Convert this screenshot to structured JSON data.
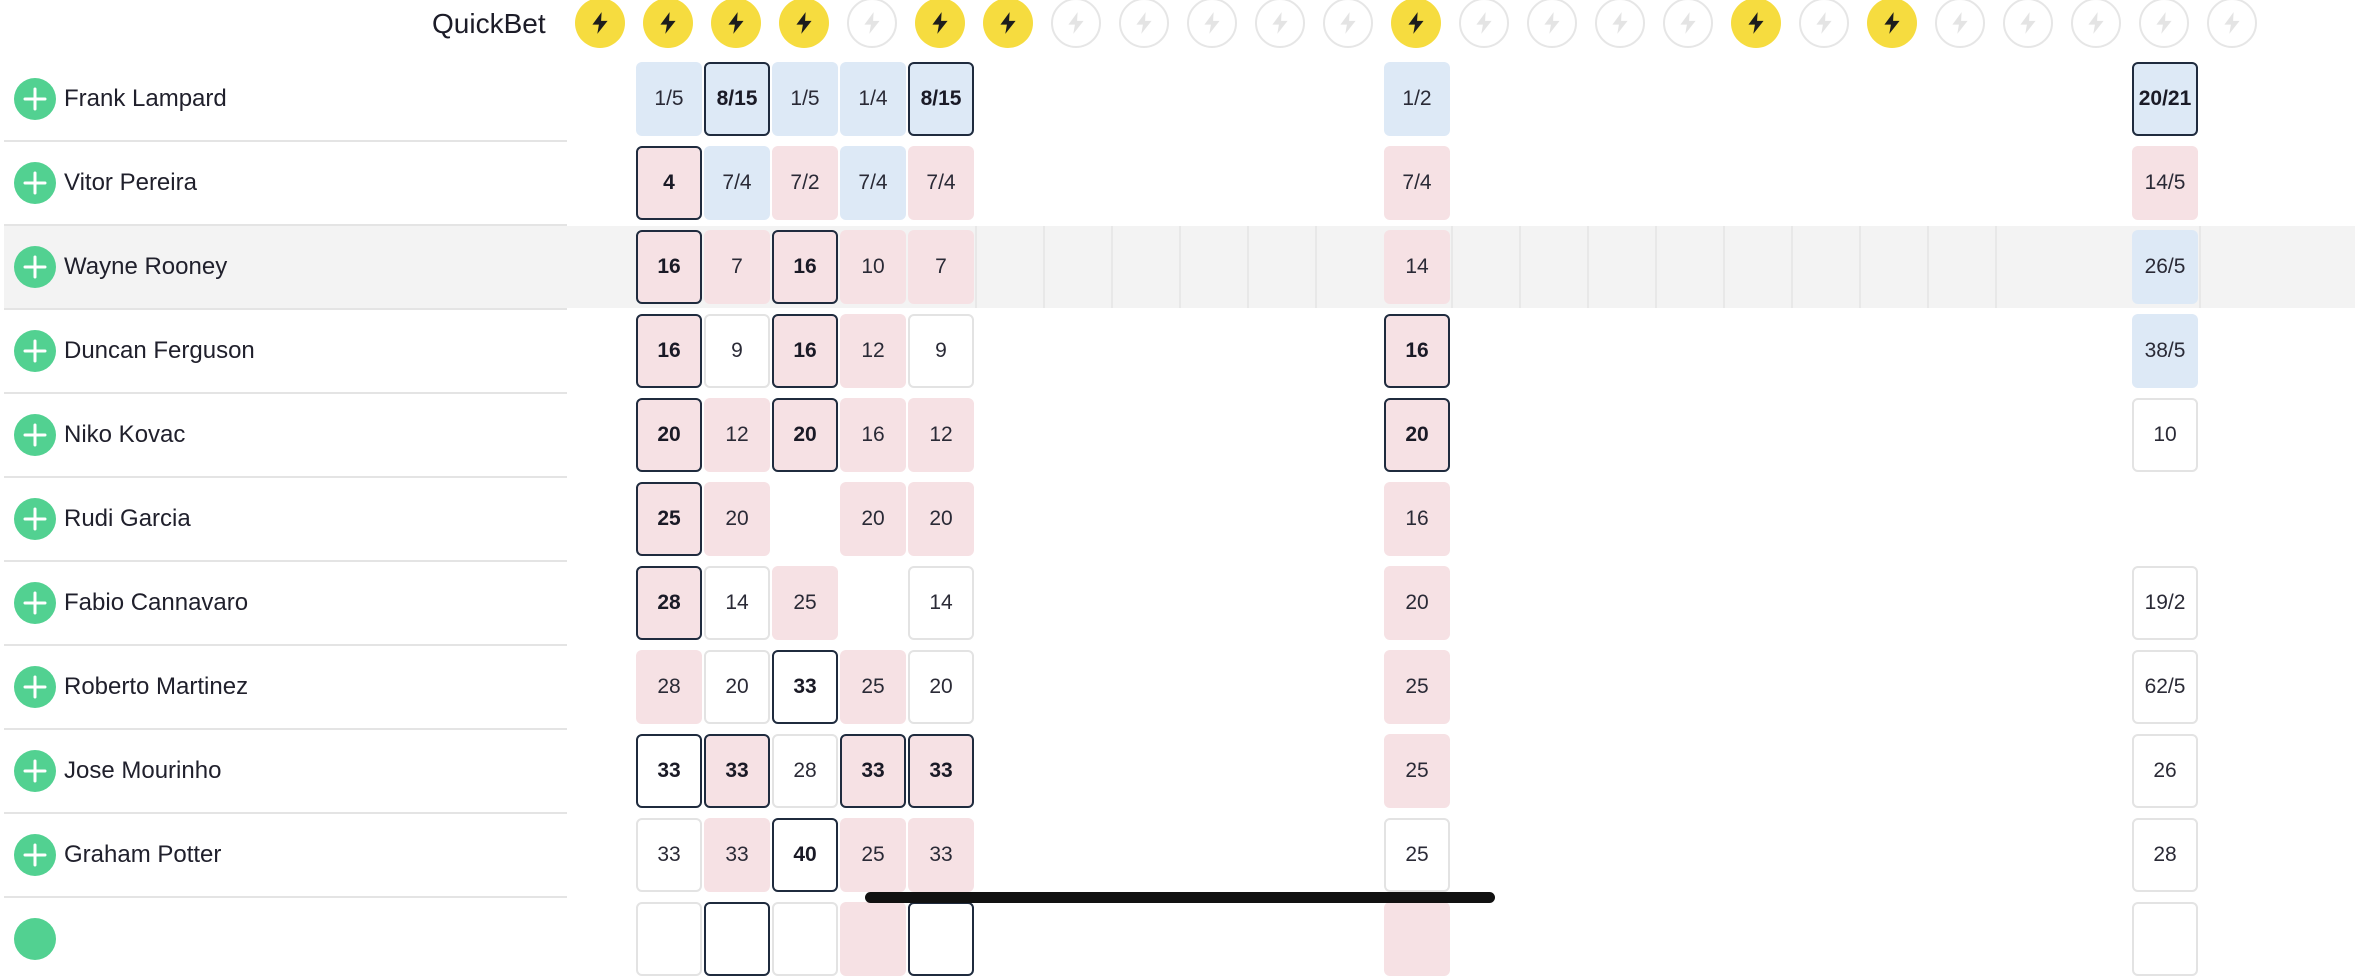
{
  "quickbet": {
    "label": "QuickBet",
    "states": [
      true,
      true,
      true,
      true,
      false,
      true,
      true,
      false,
      false,
      false,
      false,
      false,
      true,
      false,
      false,
      false,
      false,
      true,
      false,
      true,
      false,
      false,
      false,
      false,
      false
    ]
  },
  "icons": {
    "quickbet": "lightning-bolt-icon",
    "add": "plus-icon"
  },
  "colors": {
    "quickbet_on": "#f6dc3f",
    "add_button": "#52d191",
    "odds_shortening": "#dde9f6",
    "odds_drifting": "#f6e1e4",
    "best_price_border": "#1f2b3e"
  },
  "rows": [
    {
      "name": "Frank Lampard",
      "odds": [
        {
          "c": 1,
          "v": "1/5",
          "t": "b"
        },
        {
          "c": 2,
          "v": "8/15",
          "t": "b",
          "best": true
        },
        {
          "c": 3,
          "v": "1/5",
          "t": "b"
        },
        {
          "c": 4,
          "v": "1/4",
          "t": "b"
        },
        {
          "c": 5,
          "v": "8/15",
          "t": "b",
          "best": true
        },
        {
          "c": 12,
          "v": "1/2",
          "t": "b"
        },
        {
          "c": 23,
          "v": "20/21",
          "t": "b",
          "best": true
        }
      ]
    },
    {
      "name": "Vitor Pereira",
      "odds": [
        {
          "c": 1,
          "v": "4",
          "t": "p",
          "best": true
        },
        {
          "c": 2,
          "v": "7/4",
          "t": "b"
        },
        {
          "c": 3,
          "v": "7/2",
          "t": "p"
        },
        {
          "c": 4,
          "v": "7/4",
          "t": "b"
        },
        {
          "c": 5,
          "v": "7/4",
          "t": "p"
        },
        {
          "c": 12,
          "v": "7/4",
          "t": "p"
        },
        {
          "c": 23,
          "v": "14/5",
          "t": "p"
        }
      ]
    },
    {
      "name": "Wayne Rooney",
      "odds": [
        {
          "c": 1,
          "v": "16",
          "t": "p",
          "best": true
        },
        {
          "c": 2,
          "v": "7",
          "t": "p"
        },
        {
          "c": 3,
          "v": "16",
          "t": "p",
          "best": true
        },
        {
          "c": 4,
          "v": "10",
          "t": "p"
        },
        {
          "c": 5,
          "v": "7",
          "t": "p"
        },
        {
          "c": 12,
          "v": "14",
          "t": "p"
        },
        {
          "c": 23,
          "v": "26/5",
          "t": "b"
        }
      ]
    },
    {
      "name": "Duncan Ferguson",
      "odds": [
        {
          "c": 1,
          "v": "16",
          "t": "p",
          "best": true
        },
        {
          "c": 2,
          "v": "9",
          "t": "w"
        },
        {
          "c": 3,
          "v": "16",
          "t": "p",
          "best": true
        },
        {
          "c": 4,
          "v": "12",
          "t": "p"
        },
        {
          "c": 5,
          "v": "9",
          "t": "w"
        },
        {
          "c": 12,
          "v": "16",
          "t": "p",
          "best": true
        },
        {
          "c": 23,
          "v": "38/5",
          "t": "b"
        }
      ]
    },
    {
      "name": "Niko Kovac",
      "odds": [
        {
          "c": 1,
          "v": "20",
          "t": "p",
          "best": true
        },
        {
          "c": 2,
          "v": "12",
          "t": "p"
        },
        {
          "c": 3,
          "v": "20",
          "t": "p",
          "best": true
        },
        {
          "c": 4,
          "v": "16",
          "t": "p"
        },
        {
          "c": 5,
          "v": "12",
          "t": "p"
        },
        {
          "c": 12,
          "v": "20",
          "t": "p",
          "best": true
        },
        {
          "c": 23,
          "v": "10",
          "t": "w"
        }
      ]
    },
    {
      "name": "Rudi Garcia",
      "odds": [
        {
          "c": 1,
          "v": "25",
          "t": "p",
          "best": true
        },
        {
          "c": 2,
          "v": "20",
          "t": "p"
        },
        {
          "c": 4,
          "v": "20",
          "t": "p"
        },
        {
          "c": 5,
          "v": "20",
          "t": "p"
        },
        {
          "c": 12,
          "v": "16",
          "t": "p"
        }
      ]
    },
    {
      "name": "Fabio Cannavaro",
      "odds": [
        {
          "c": 1,
          "v": "28",
          "t": "p",
          "best": true
        },
        {
          "c": 2,
          "v": "14",
          "t": "w"
        },
        {
          "c": 3,
          "v": "25",
          "t": "p"
        },
        {
          "c": 5,
          "v": "14",
          "t": "w"
        },
        {
          "c": 12,
          "v": "20",
          "t": "p"
        },
        {
          "c": 23,
          "v": "19/2",
          "t": "w"
        }
      ]
    },
    {
      "name": "Roberto Martinez",
      "odds": [
        {
          "c": 1,
          "v": "28",
          "t": "p"
        },
        {
          "c": 2,
          "v": "20",
          "t": "w"
        },
        {
          "c": 3,
          "v": "33",
          "t": "w",
          "best": true
        },
        {
          "c": 4,
          "v": "25",
          "t": "p"
        },
        {
          "c": 5,
          "v": "20",
          "t": "w"
        },
        {
          "c": 12,
          "v": "25",
          "t": "p"
        },
        {
          "c": 23,
          "v": "62/5",
          "t": "w"
        }
      ]
    },
    {
      "name": "Jose Mourinho",
      "odds": [
        {
          "c": 1,
          "v": "33",
          "t": "w",
          "best": true
        },
        {
          "c": 2,
          "v": "33",
          "t": "p",
          "best": true
        },
        {
          "c": 3,
          "v": "28",
          "t": "w"
        },
        {
          "c": 4,
          "v": "33",
          "t": "p",
          "best": true
        },
        {
          "c": 5,
          "v": "33",
          "t": "p",
          "best": true
        },
        {
          "c": 12,
          "v": "25",
          "t": "p"
        },
        {
          "c": 23,
          "v": "26",
          "t": "w"
        }
      ]
    },
    {
      "name": "Graham Potter",
      "odds": [
        {
          "c": 1,
          "v": "33",
          "t": "w"
        },
        {
          "c": 2,
          "v": "33",
          "t": "p"
        },
        {
          "c": 3,
          "v": "40",
          "t": "w",
          "best": true
        },
        {
          "c": 4,
          "v": "25",
          "t": "p"
        },
        {
          "c": 5,
          "v": "33",
          "t": "p"
        },
        {
          "c": 12,
          "v": "25",
          "t": "w"
        },
        {
          "c": 23,
          "v": "28",
          "t": "w"
        }
      ]
    }
  ]
}
